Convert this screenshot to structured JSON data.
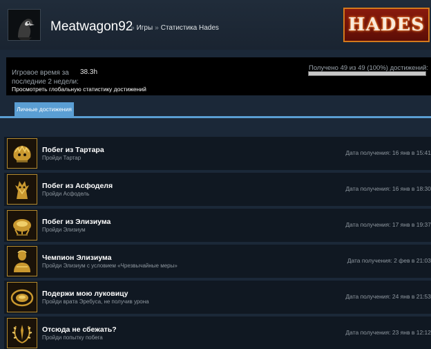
{
  "header": {
    "profile_name": "Meatwagon92",
    "breadcrumb": [
      {
        "label": "Игры"
      },
      {
        "label": "Статистика Hades"
      }
    ],
    "breadcrumb_separator": "»",
    "game_logo_text": "HADES"
  },
  "stats": {
    "playtime_label": "Игровое время за последние 2 недели:",
    "playtime_value": "38.3h",
    "global_stats_link": "Просмотреть глобальную статистику достижений",
    "progress_text": "Получено 49 из 49 (100%) достижений:",
    "progress_fraction": 1.0
  },
  "tabs": [
    {
      "label": "Личные достижения",
      "active": true
    }
  ],
  "achievements": [
    {
      "name": "Побег из Тартара",
      "description": "Пройди Тартар",
      "date": "Дата получения: 16 янв в 15:41",
      "icon": "skull-trophy-icon"
    },
    {
      "name": "Побег из Асфоделя",
      "description": "Пройди Асфодель",
      "date": "Дата получения: 16 янв в 18:30",
      "icon": "bone-hydra-icon"
    },
    {
      "name": "Побег из Элизиума",
      "description": "Пройди Элизиум",
      "date": "Дата получения: 17 янв в 19:37",
      "icon": "chariot-icon"
    },
    {
      "name": "Чемпион Элизиума",
      "description": "Пройди Элизиум с условием «Чрезвычайные меры»",
      "date": "Дата получения: 2 фев в 21:03",
      "icon": "bust-icon"
    },
    {
      "name": "Подержи мою луковицу",
      "description": "Пройди врата Эребуса, не получив урона",
      "date": "Дата получения: 24 янв в 21:53",
      "icon": "onion-icon"
    },
    {
      "name": "Отсюда не сбежать?",
      "description": "Пройди попытку побега",
      "date": "Дата получения: 23 янв в 12:12",
      "icon": "laurel-icon"
    }
  ],
  "colors": {
    "background": "#1b2838",
    "accent": "#5a9ed3",
    "row_bg": "#101822",
    "icon_gold": "#d4a73c"
  }
}
